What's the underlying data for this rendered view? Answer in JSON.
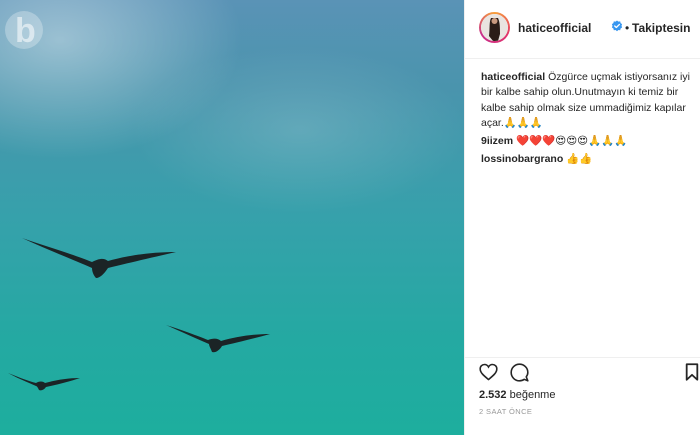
{
  "header": {
    "username": "haticeofficial",
    "separator": "•",
    "follow_status": "Takiptesin"
  },
  "comments": [
    {
      "username": "haticeofficial",
      "text": "Özgürce uçmak istiyorsanız iyi bir kalbe sahip olun.Unutmayın ki temiz bir kalbe sahip olmak size ummadiğimiz kapılar açar.",
      "emojis": "🙏🙏🙏"
    },
    {
      "username": "9iizem",
      "text": "",
      "emojis": "❤️❤️❤️😍😍😍🙏🙏🙏"
    },
    {
      "username": "lossinobargrano",
      "text": "",
      "emojis": "👍👍"
    }
  ],
  "footer": {
    "likes_count": "2.532",
    "likes_label": "beğenme",
    "timestamp": "2 SAAT ÖNCE"
  },
  "icons": {
    "like": "heart-icon",
    "comment": "comment-icon",
    "save": "bookmark-icon",
    "verified": "verified-badge-icon",
    "watermark": "watermark-logo-icon"
  },
  "colors": {
    "verified_blue": "#3897f0",
    "text": "#262626",
    "meta": "#999999"
  }
}
